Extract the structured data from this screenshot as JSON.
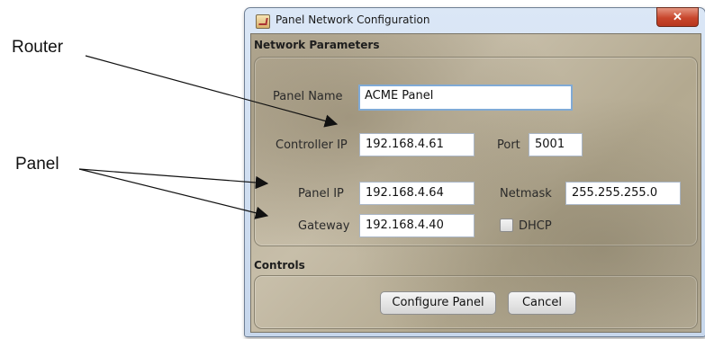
{
  "callouts": {
    "router": "Router",
    "panel": "Panel"
  },
  "window": {
    "title": "Panel Network Configuration",
    "close_label": "✕"
  },
  "network_parameters": {
    "section_title": "Network Parameters",
    "panel_name": {
      "label": "Panel Name",
      "value": "ACME Panel"
    },
    "controller_ip": {
      "label": "Controller IP",
      "value": "192.168.4.61"
    },
    "port": {
      "label": "Port",
      "value": "5001"
    },
    "panel_ip": {
      "label": "Panel IP",
      "value": "192.168.4.64"
    },
    "netmask": {
      "label": "Netmask",
      "value": "255.255.255.0"
    },
    "gateway": {
      "label": "Gateway",
      "value": "192.168.4.40"
    },
    "dhcp": {
      "label": "DHCP",
      "checked": false
    }
  },
  "controls": {
    "section_title": "Controls",
    "configure_label": "Configure Panel",
    "cancel_label": "Cancel"
  },
  "icons": {
    "app": "java-cup-icon",
    "close": "close-icon"
  }
}
